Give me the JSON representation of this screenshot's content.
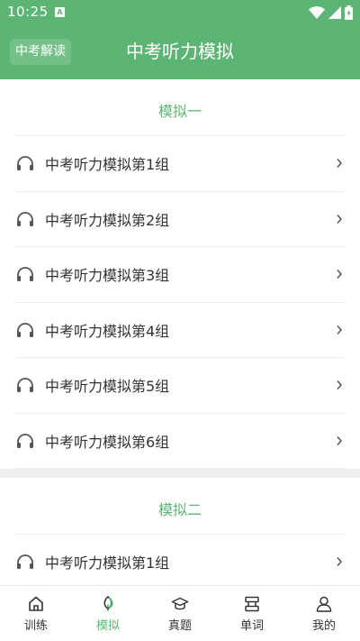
{
  "statusbar": {
    "time": "10:25",
    "sim_letter": "A"
  },
  "header": {
    "back_label": "中考解读",
    "title": "中考听力模拟"
  },
  "sections": [
    {
      "title": "模拟一",
      "items": [
        "中考听力模拟第1组",
        "中考听力模拟第2组",
        "中考听力模拟第3组",
        "中考听力模拟第4组",
        "中考听力模拟第5组",
        "中考听力模拟第6组"
      ]
    },
    {
      "title": "模拟二",
      "items": [
        "中考听力模拟第1组"
      ]
    }
  ],
  "tabs": [
    {
      "label": "训练",
      "icon": "home-icon",
      "active": false
    },
    {
      "label": "模拟",
      "icon": "leaf-icon",
      "active": true
    },
    {
      "label": "真题",
      "icon": "graduation-cap-icon",
      "active": false
    },
    {
      "label": "单词",
      "icon": "book-stack-icon",
      "active": false
    },
    {
      "label": "我的",
      "icon": "user-icon",
      "active": false
    }
  ],
  "colors": {
    "accent": "#5cb574",
    "text": "#333333",
    "divider": "#ececec"
  }
}
